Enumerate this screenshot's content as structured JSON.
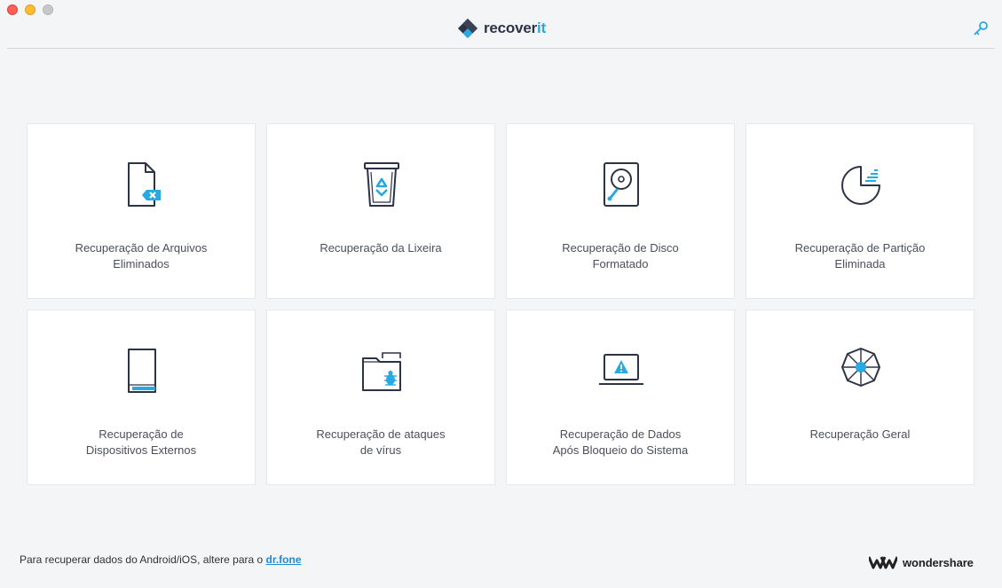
{
  "window": {
    "controls": [
      "close",
      "minimize",
      "maximize"
    ]
  },
  "header": {
    "brand_main": "recover",
    "brand_accent": "it",
    "key_icon": "key-icon"
  },
  "cards": [
    {
      "label": "Recuperação de Arquivos\nEliminados",
      "icon": "deleted-file-icon"
    },
    {
      "label": "Recuperação da Lixeira",
      "icon": "recycle-bin-icon"
    },
    {
      "label": "Recuperação de Disco\nFormatado",
      "icon": "formatted-disk-icon"
    },
    {
      "label": "Recuperação de Partição\nEliminada",
      "icon": "partition-icon"
    },
    {
      "label": "Recuperação de\nDispositivos Externos",
      "icon": "external-device-icon"
    },
    {
      "label": "Recuperação de ataques\nde vírus",
      "icon": "virus-folder-icon"
    },
    {
      "label": "Recuperação de Dados\nApós Bloqueio do Sistema",
      "icon": "system-crash-icon"
    },
    {
      "label": "Recuperação Geral",
      "icon": "all-around-icon"
    }
  ],
  "footer": {
    "note_text": "Para recuperar dados do Android/iOS, altere para o ",
    "note_link": "dr.fone",
    "brand": "wondershare"
  },
  "colors": {
    "accent": "#29a9e1",
    "icon_stroke": "#2d3346",
    "link": "#1f8ad6"
  }
}
